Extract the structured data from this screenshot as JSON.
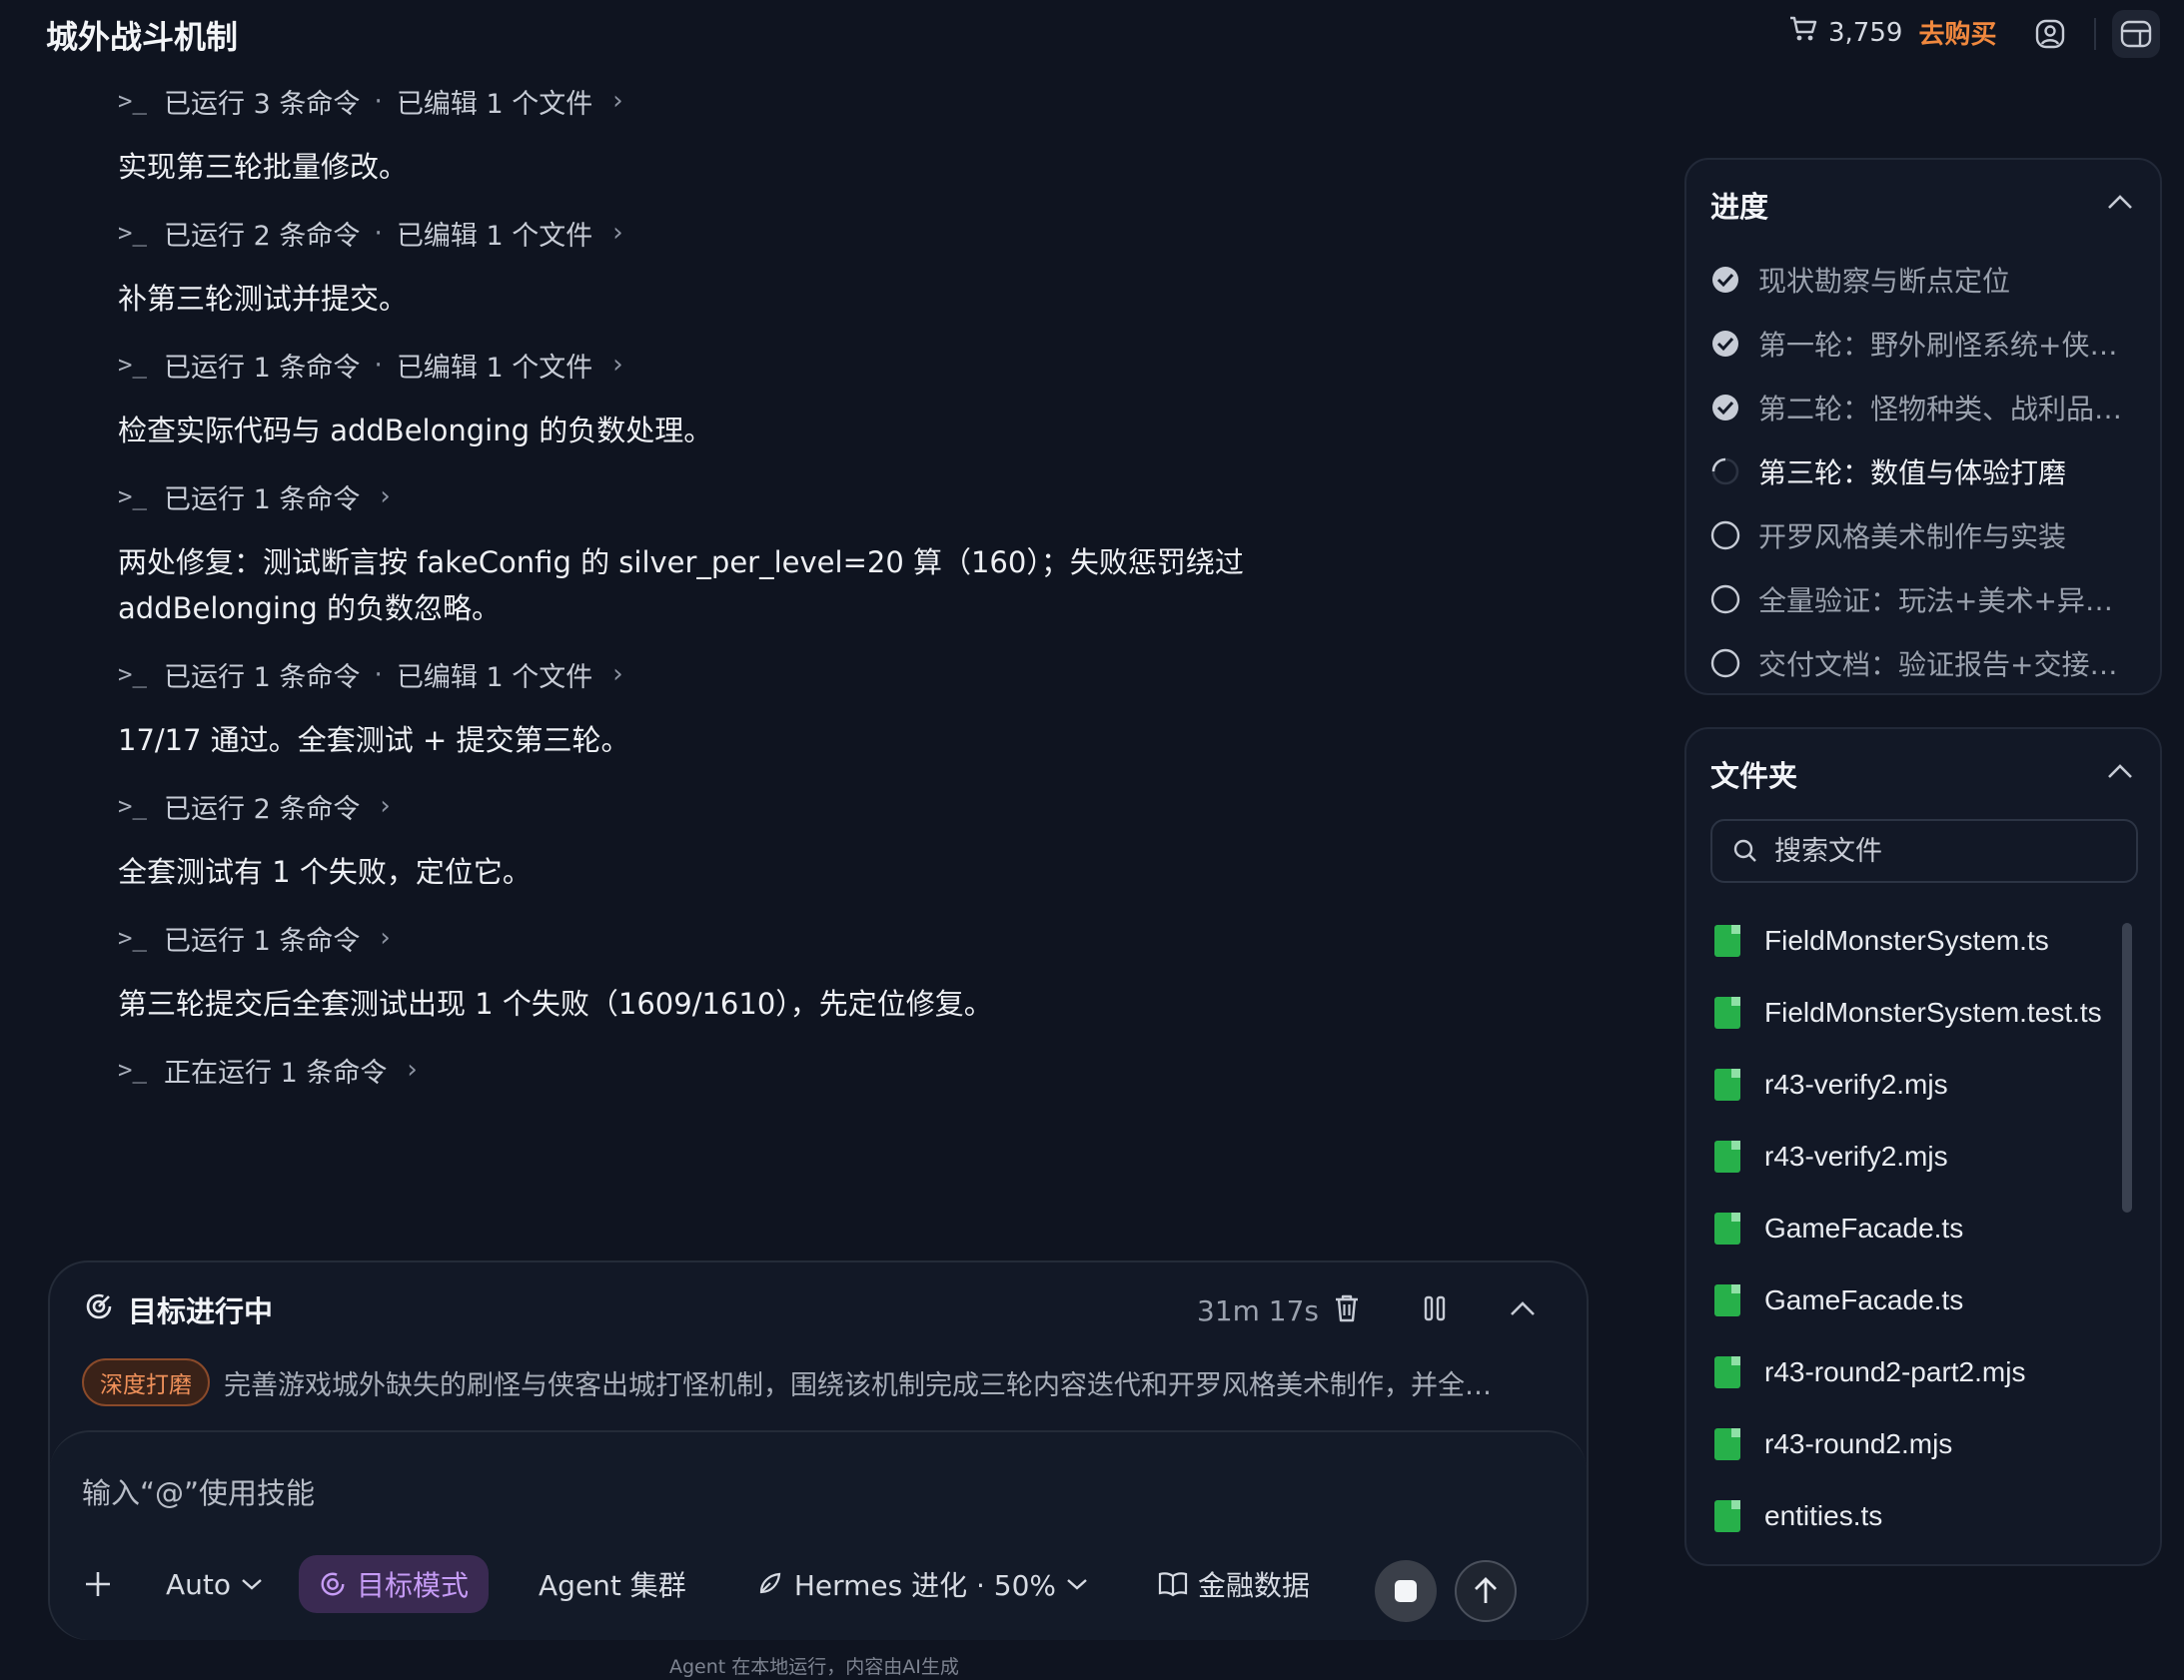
{
  "app": {
    "title": "城外战斗机制"
  },
  "header": {
    "credits": "3,759",
    "buy_label": "去购买"
  },
  "feed": {
    "items": [
      {
        "type": "cmd",
        "text": "已运行 3 条命令",
        "extra": "已编辑 1 个文件"
      },
      {
        "type": "msg",
        "text": "实现第三轮批量修改。"
      },
      {
        "type": "cmd",
        "text": "已运行 2 条命令",
        "extra": "已编辑 1 个文件"
      },
      {
        "type": "msg",
        "text": "补第三轮测试并提交。"
      },
      {
        "type": "cmd",
        "text": "已运行 1 条命令",
        "extra": "已编辑 1 个文件"
      },
      {
        "type": "msg",
        "text": "检查实际代码与 addBelonging 的负数处理。"
      },
      {
        "type": "cmd",
        "text": "已运行 1 条命令",
        "extra": ""
      },
      {
        "type": "msg",
        "text": "两处修复：测试断言按 fakeConfig 的 silver_per_level=20 算（160）；失败惩罚绕过 addBelonging 的负数忽略。"
      },
      {
        "type": "cmd",
        "text": "已运行 1 条命令",
        "extra": "已编辑 1 个文件"
      },
      {
        "type": "msg",
        "text": "17/17 通过。全套测试 + 提交第三轮。"
      },
      {
        "type": "cmd",
        "text": "已运行 2 条命令",
        "extra": ""
      },
      {
        "type": "msg",
        "text": "全套测试有 1 个失败，定位它。"
      },
      {
        "type": "cmd",
        "text": "已运行 1 条命令",
        "extra": ""
      },
      {
        "type": "msg",
        "text": "第三轮提交后全套测试出现 1 个失败（1609/1610），先定位修复。"
      },
      {
        "type": "cmd",
        "text": "正在运行 1 条命令",
        "extra": ""
      }
    ]
  },
  "goal": {
    "title": "目标进行中",
    "elapsed": "31m 17s",
    "tag": "深度打磨",
    "description": "完善游戏城外缺失的刷怪与侠客出城打怪机制，围绕该机制完成三轮内容迭代和开罗风格美术制作，并全…"
  },
  "composer": {
    "placeholder": "输入“@”使用技能",
    "model": "Auto",
    "goal_mode": "目标模式",
    "agent_cluster": "Agent 集群",
    "hermes": "Hermes 进化 · 50%",
    "finance": "金融数据",
    "footnote": "Agent 在本地运行，内容由AI生成"
  },
  "progress": {
    "title": "进度",
    "steps": [
      {
        "label": "现状勘察与断点定位",
        "status": "done"
      },
      {
        "label": "第一轮：野外刷怪系统+侠客…",
        "status": "done"
      },
      {
        "label": "第二轮：怪物种类、战利品…",
        "status": "done"
      },
      {
        "label": "第三轮：数值与体验打磨",
        "status": "current"
      },
      {
        "label": "开罗风格美术制作与实装",
        "status": "pending"
      },
      {
        "label": "全量验证：玩法+美术+异常…",
        "status": "pending"
      },
      {
        "label": "交付文档：验证报告+交接说明",
        "status": "pending"
      }
    ]
  },
  "folder": {
    "title": "文件夹",
    "search_placeholder": "搜索文件",
    "files": [
      "FieldMonsterSystem.ts",
      "FieldMonsterSystem.test.ts",
      "r43-verify2.mjs",
      "r43-verify2.mjs",
      "GameFacade.ts",
      "GameFacade.ts",
      "r43-round2-part2.mjs",
      "r43-round2.mjs",
      "entities.ts"
    ]
  },
  "colors": {
    "accent": "#c69cf6",
    "buy": "#f0883e",
    "file": "#27b04a"
  }
}
